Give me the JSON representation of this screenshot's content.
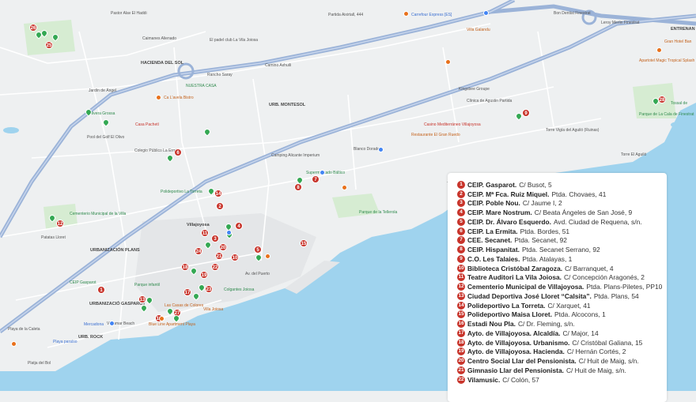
{
  "colors": {
    "land": "#eef0f1",
    "sea": "#9fd3ee",
    "highway": "#9bb3d8",
    "marker": "#c8342b",
    "park": "#d6ecd2"
  },
  "places": [
    {
      "text": "Pastor Alav El Haddi",
      "cls": ""
    },
    {
      "text": "Partida Aixirtall, 444",
      "cls": ""
    },
    {
      "text": "Carrefour Express [ES]",
      "cls": "blue"
    },
    {
      "text": "Bon Dentist Finestrat",
      "cls": ""
    },
    {
      "text": "ENTRENAN",
      "cls": "bold"
    },
    {
      "text": "Caimanes Alienado",
      "cls": ""
    },
    {
      "text": "El padel club La Vila Joiosa",
      "cls": ""
    },
    {
      "text": "Villa Galandu",
      "cls": "orange"
    },
    {
      "text": "Leroy Merlin Finestrat",
      "cls": ""
    },
    {
      "text": "Gran Hotel Ban",
      "cls": "orange"
    },
    {
      "text": "HACIENDA DEL SOL",
      "cls": "bold"
    },
    {
      "text": "Camino Axhuili",
      "cls": ""
    },
    {
      "text": "Apartotel Magic Tropical Splash",
      "cls": "orange"
    },
    {
      "text": "Jardín de Ángel",
      "cls": ""
    },
    {
      "text": "Rancho Saray",
      "cls": ""
    },
    {
      "text": "NUESTRA CASA",
      "cls": "green"
    },
    {
      "text": "Kingsbee Groupe",
      "cls": ""
    },
    {
      "text": "Clínica de Agustin Partida",
      "cls": ""
    },
    {
      "text": "Tossal de",
      "cls": "green"
    },
    {
      "text": "l'Olivera Grossa",
      "cls": "green"
    },
    {
      "text": "Ca L'avela Bistro",
      "cls": "orange"
    },
    {
      "text": "URB. MONTESOL",
      "cls": "bold"
    },
    {
      "text": "Casa Pachetí",
      "cls": "red"
    },
    {
      "text": "Casino Mediterráneo Villajoyosa",
      "cls": "red"
    },
    {
      "text": "Parque de La Cala de Finestrat",
      "cls": "green"
    },
    {
      "text": "Pool del Golf El Olivo",
      "cls": ""
    },
    {
      "text": "Torre Vigía del Aguiló (Ruinas)",
      "cls": ""
    },
    {
      "text": "Restaurante El Gran Ruedo",
      "cls": "orange"
    },
    {
      "text": "Colegio Público La Ermita",
      "cls": ""
    },
    {
      "text": "Blanco Dorado",
      "cls": ""
    },
    {
      "text": "Torre El Aguiló",
      "cls": ""
    },
    {
      "text": "Camping Alicante Imperium",
      "cls": ""
    },
    {
      "text": "Supermercado Báltico",
      "cls": "green"
    },
    {
      "text": "Polideportivo La Torreta",
      "cls": "green"
    },
    {
      "text": "Torre de Hercules",
      "cls": ""
    },
    {
      "text": "Villajoyosa",
      "cls": "bold"
    },
    {
      "text": "Cementerio Municipal de la Villa",
      "cls": "green"
    },
    {
      "text": "Parque de la Tellerola",
      "cls": "green"
    },
    {
      "text": "Patatas Lloret",
      "cls": ""
    },
    {
      "text": "URBANIZACIÓN PLANS",
      "cls": "bold"
    },
    {
      "text": "CEIP Gasparot",
      "cls": "green"
    },
    {
      "text": "Parque infantil",
      "cls": "green"
    },
    {
      "text": "URBANIZACIÓ GASPAROT",
      "cls": "bold"
    },
    {
      "text": "Las Casas de Colores",
      "cls": "orange"
    },
    {
      "text": "Mercadona",
      "cls": "blue"
    },
    {
      "text": "Vistamar Beach",
      "cls": ""
    },
    {
      "text": "Blue Line Apartment Playa",
      "cls": "orange"
    },
    {
      "text": "Playa paraíso",
      "cls": "blue"
    },
    {
      "text": "URB. ROCK",
      "cls": "bold"
    },
    {
      "text": "Playa de la Caleta",
      "cls": ""
    },
    {
      "text": "Platja del Bol",
      "cls": ""
    },
    {
      "text": "Villa Joiosa",
      "cls": "orange"
    },
    {
      "text": "Colgantes Joiosa",
      "cls": "green"
    },
    {
      "text": "Av. del Puerto",
      "cls": ""
    }
  ],
  "map_markers": [
    "26",
    "25",
    "12",
    "6",
    "14",
    "2",
    "4",
    "11",
    "3",
    "24",
    "20",
    "21",
    "5",
    "15",
    "22",
    "19",
    "18",
    "17",
    "23",
    "13",
    "16",
    "27",
    "1",
    "8",
    "7",
    "9",
    "28",
    "10"
  ],
  "legend": [
    {
      "n": "1",
      "name": "CEIP. Gasparot.",
      "addr": "C/ Busot, 5"
    },
    {
      "n": "2",
      "name": "CEIP. Mª Fca. Ruiz Miquel.",
      "addr": "Ptda. Chovaes, 41"
    },
    {
      "n": "3",
      "name": "CEIP. Poble Nou.",
      "addr": "C/ Jaume I, 2"
    },
    {
      "n": "4",
      "name": "CEIP. Mare Nostrum.",
      "addr": "C/ Beata Ángeles de San José, 9"
    },
    {
      "n": "5",
      "name": "CEIP. Dr. Álvaro Esquerdo.",
      "addr": "Avd. Ciudad de Requena, s/n."
    },
    {
      "n": "6",
      "name": "CEIP. La Ermita.",
      "addr": "Ptda. Bordes, 51"
    },
    {
      "n": "7",
      "name": "CEE. Secanet.",
      "addr": "Ptda. Secanet, 92"
    },
    {
      "n": "8",
      "name": "CEIP. Hispanitat.",
      "addr": "Ptda. Secanet Serrano, 92"
    },
    {
      "n": "9",
      "name": "C.O. Les Talaies.",
      "addr": "Ptda. Atalayas, 1"
    },
    {
      "n": "10",
      "name": "Biblioteca Cristóbal Zaragoza.",
      "addr": "C/ Barranquet, 4"
    },
    {
      "n": "11",
      "name": "Teatre Auditori La Vila Joiosa.",
      "addr": "C/ Concepción Aragonés, 2"
    },
    {
      "n": "12",
      "name": "Cementerio Municipal de Villajoyosa.",
      "addr": "Ptda. Plans-Piletes, PP10"
    },
    {
      "n": "13",
      "name": "Ciudad Deportiva José Lloret “Calsita”.",
      "addr": "Ptda. Plans, 54"
    },
    {
      "n": "14",
      "name": "Polideportivo La Torreta.",
      "addr": "C/ Xarquet, 41"
    },
    {
      "n": "15",
      "name": "Polideportivo Maisa Lloret.",
      "addr": "Ptda. Alcocons, 1"
    },
    {
      "n": "16",
      "name": "Estadi Nou Pla.",
      "addr": "C/ Dr. Fleming, s/n."
    },
    {
      "n": "17",
      "name": "Ayto. de Villajoyosa. Alcaldía.",
      "addr": "C/ Major, 14"
    },
    {
      "n": "18",
      "name": "Ayto. de Villajoyosa. Urbanismo.",
      "addr": "C/ Cristóbal Galiana, 15"
    },
    {
      "n": "19",
      "name": "Ayto. de Villajoyosa. Hacienda.",
      "addr": "C/ Hernán Cortés, 2"
    },
    {
      "n": "20",
      "name": "Centro Social Llar del Pensionista.",
      "addr": "C/ Huit de Maig, s/n."
    },
    {
      "n": "21",
      "name": "Gimnasio Llar del Pensionista.",
      "addr": "C/ Huit de Maig, s/n."
    },
    {
      "n": "22",
      "name": "Vilamusic.",
      "addr": "C/ Colón, 57"
    }
  ]
}
